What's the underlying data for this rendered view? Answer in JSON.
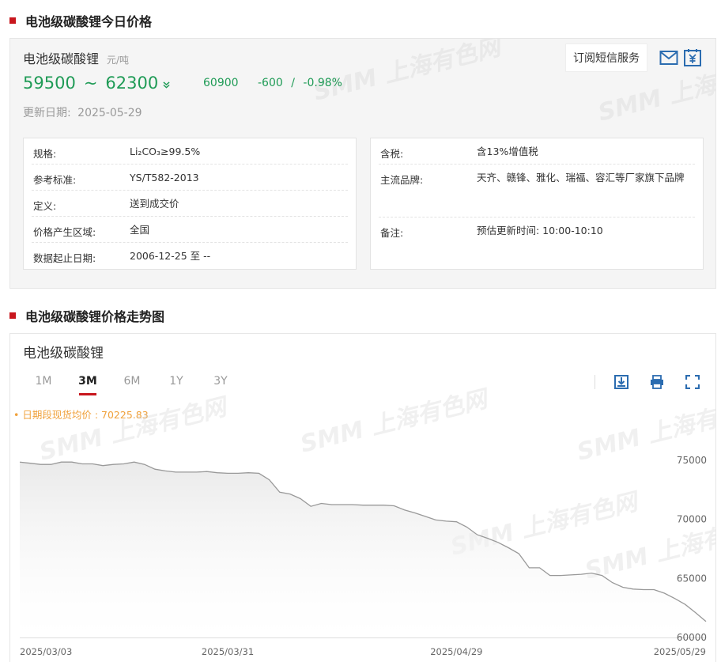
{
  "section1": {
    "title": "电池级碳酸锂今日价格"
  },
  "price": {
    "name": "电池级碳酸锂",
    "unit": "元/吨",
    "low": "59500",
    "tilde": "~",
    "high": "62300",
    "trend_icon": "double-chevron-down-icon",
    "avg": "60900",
    "change": "-600",
    "slash": "/",
    "change_pct": "-0.98%",
    "date_label": "更新日期:",
    "date_value": "2025-05-29",
    "color_down": "#1f9b56"
  },
  "watermark": {
    "brand": "SMM",
    "text": "上海有色网"
  },
  "subscribe": {
    "label": "订阅短信服务",
    "mail_icon": "mail-icon",
    "yuan_icon": "yuan-calendar-icon"
  },
  "spec_left": [
    {
      "key": "规格:",
      "value": "Li₂CO₃≥99.5%"
    },
    {
      "key": "参考标准:",
      "value": "YS/T582-2013"
    },
    {
      "key": "定义:",
      "value": "送到成交价"
    },
    {
      "key": "价格产生区域:",
      "value": "全国"
    },
    {
      "key": "数据起止日期:",
      "value": "2006-12-25 至 --"
    }
  ],
  "spec_right": [
    {
      "key": "含税:",
      "value": "含13%增值税"
    },
    {
      "key": "主流品牌:",
      "value": "天齐、赣锋、雅化、瑞福、容汇等厂家旗下品牌"
    },
    {
      "key": "备注:",
      "value": "预估更新时间: 10:00-10:10"
    }
  ],
  "section2": {
    "title": "电池级碳酸锂价格走势图"
  },
  "chart_panel": {
    "title": "电池级碳酸锂",
    "tabs": [
      "1M",
      "3M",
      "6M",
      "1Y",
      "3Y"
    ],
    "active_tab": "3M",
    "avg_label": "• 日期段现货均价 : 70225.83",
    "tools": [
      "download-icon",
      "print-icon",
      "fullscreen-icon"
    ]
  },
  "chart_data": {
    "type": "area",
    "title": "",
    "xlabel": "",
    "ylabel": "",
    "ylim": [
      60000,
      75000
    ],
    "yticks": [
      75000,
      70000,
      65000,
      60000
    ],
    "xticks": [
      "2025/03/03",
      "2025/03/31",
      "2025/04/29",
      "2025/05/29"
    ],
    "grid": false,
    "series_color": "#999999",
    "fill_color": "#e6e6e6",
    "series": [
      {
        "values": [
          74850,
          74750,
          74650,
          74650,
          74850,
          74850,
          74700,
          74700,
          74550,
          74650,
          74700,
          74850,
          74650,
          74250,
          74100,
          74000,
          74000,
          74000,
          74050,
          73950,
          73900,
          73900,
          73950,
          73900,
          73350,
          72300,
          72150,
          71750,
          71100,
          71350,
          71250,
          71250,
          71250,
          71200,
          71200,
          71200,
          71150,
          70800,
          70550,
          70250,
          69950,
          69850,
          69800,
          69350,
          68700,
          68400,
          68050,
          67600,
          67100,
          65900,
          65900,
          65250,
          65250,
          65300,
          65350,
          65450,
          65250,
          64650,
          64250,
          64100,
          64050,
          64050,
          63750,
          63300,
          62800,
          62100,
          61350
        ]
      }
    ]
  }
}
